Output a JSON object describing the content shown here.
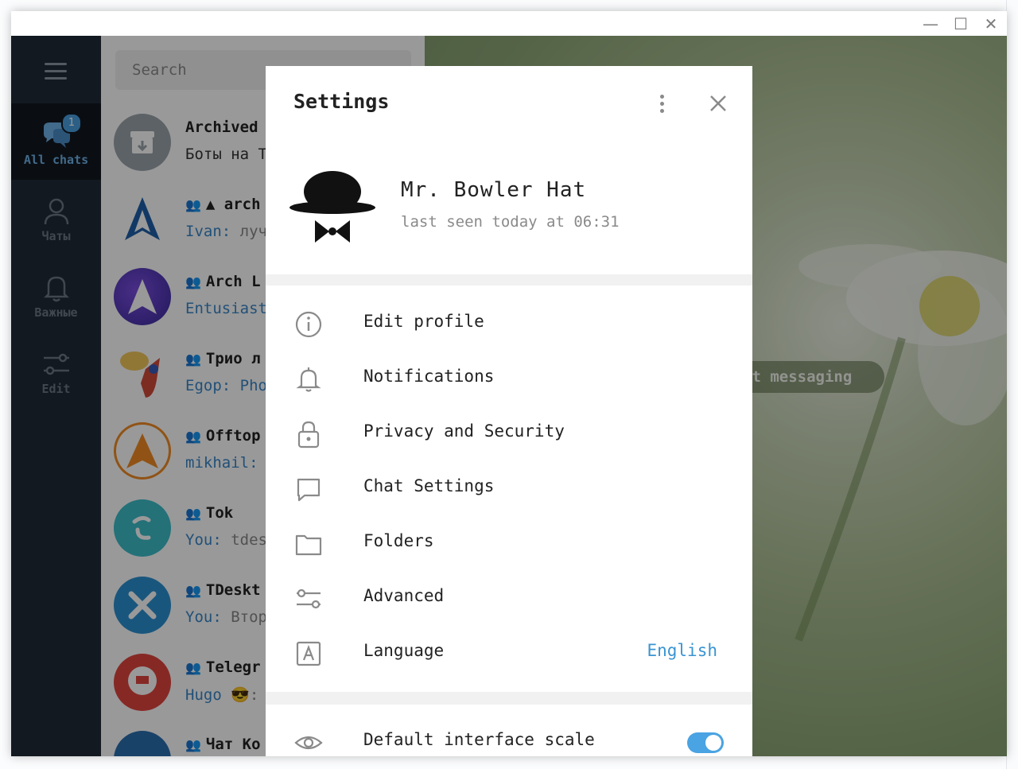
{
  "window": {
    "minimize": "—",
    "maximize": "☐",
    "close": "✕"
  },
  "folders": [
    {
      "label": "All chats",
      "badge": "1",
      "active": true,
      "icon": "chats-icon"
    },
    {
      "label": "Чаты",
      "icon": "person-icon"
    },
    {
      "label": "Важные",
      "icon": "bell-icon"
    },
    {
      "label": "Edit",
      "icon": "sliders-icon"
    }
  ],
  "search": {
    "placeholder": "Search"
  },
  "chats": [
    {
      "title": "Archived",
      "sub_sender": "Боты на Т",
      "sub_text": ""
    },
    {
      "title": "▲ arch",
      "sub_sender": "Ivan:",
      "sub_text": " лучш"
    },
    {
      "title": "Arch L",
      "sub_sender": "Entusiast",
      "sub_text": ""
    },
    {
      "title": "Трио л",
      "sub_sender": "Egop: Pho",
      "sub_text": ""
    },
    {
      "title": "Offtop",
      "sub_sender": "mikhail:",
      "sub_text": ""
    },
    {
      "title": "Tok",
      "sub_sender": "You:",
      "sub_text": " tdes"
    },
    {
      "title": "TDeskt",
      "sub_sender": "You:",
      "sub_text": " Втор"
    },
    {
      "title": "Telegr",
      "sub_sender": "Hugo",
      "sub_text": " 😎:"
    },
    {
      "title": "Чат Ко",
      "sub_sender": "",
      "sub_text": ""
    }
  ],
  "chat_bg": {
    "pill_text": "rt messaging"
  },
  "settings": {
    "title": "Settings",
    "profile": {
      "name": "Mr. Bowler Hat",
      "status": "last seen today at 06:31"
    },
    "menu": [
      {
        "label": "Edit profile",
        "icon": "info-icon"
      },
      {
        "label": "Notifications",
        "icon": "bell-icon"
      },
      {
        "label": "Privacy and Security",
        "icon": "lock-icon"
      },
      {
        "label": "Chat Settings",
        "icon": "chat-bubble-icon"
      },
      {
        "label": "Folders",
        "icon": "folder-icon"
      },
      {
        "label": "Advanced",
        "icon": "sliders-icon"
      },
      {
        "label": "Language",
        "icon": "language-icon",
        "value": "English"
      }
    ],
    "scale": {
      "label": "Default interface scale",
      "enabled": true
    }
  },
  "colors": {
    "accent": "#4aa3e2",
    "sidebar": "#212a36",
    "link": "#3a86c8"
  }
}
